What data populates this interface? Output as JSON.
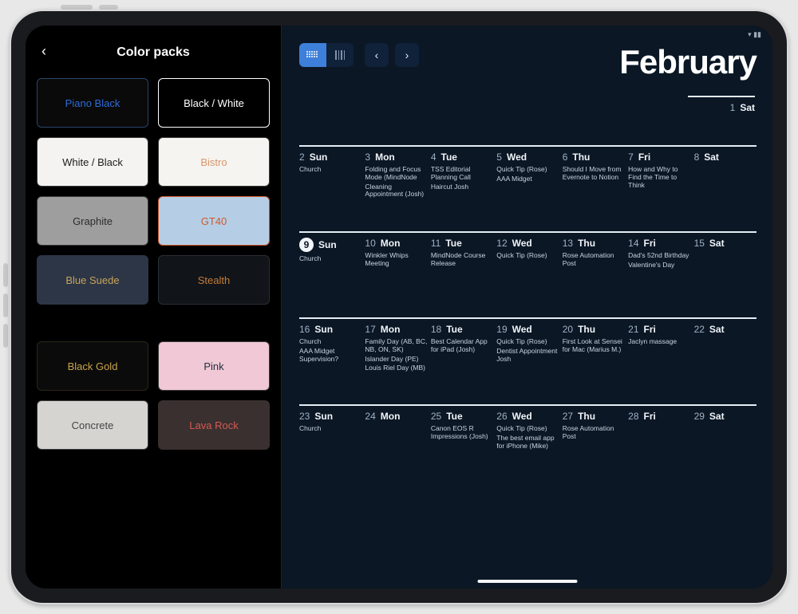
{
  "left": {
    "title": "Color packs",
    "packs": [
      {
        "label": "Piano Black",
        "bg": "#0a0a0a",
        "fg": "#2f6bd6",
        "border": "#29446b"
      },
      {
        "label": "Black / White",
        "bg": "#000000",
        "fg": "#ffffff",
        "border": "#ffffff"
      },
      {
        "label": "White / Black",
        "bg": "#f4f3f1",
        "fg": "#1c1c1c",
        "border": "#3a3a3a"
      },
      {
        "label": "Bistro",
        "bg": "#f6f4f0",
        "fg": "#d7956c",
        "border": "#3a3a3a"
      },
      {
        "label": "Graphite",
        "bg": "#9e9e9e",
        "fg": "#2c2c2c",
        "border": "#3a3a3a"
      },
      {
        "label": "GT40",
        "bg": "#b5cee6",
        "fg": "#d05a2a",
        "border": "#d05a2a"
      },
      {
        "label": "Blue Suede",
        "bg": "#2c3646",
        "fg": "#c9a35b",
        "border": "#2c3646"
      },
      {
        "label": "Stealth",
        "bg": "#111418",
        "fg": "#c77d3a",
        "border": "#2a2f35"
      }
    ],
    "packs2": [
      {
        "label": "Black Gold",
        "bg": "#0b0b0b",
        "fg": "#c9a54a",
        "border": "#2a2618"
      },
      {
        "label": "Pink",
        "bg": "#f1c8d5",
        "fg": "#233041",
        "border": "#3a3a3a"
      },
      {
        "label": "Concrete",
        "bg": "#d6d4d0",
        "fg": "#444444",
        "border": "#3a3a3a"
      },
      {
        "label": "Lava Rock",
        "bg": "#3a3030",
        "fg": "#d45a52",
        "border": "#3a3030"
      }
    ]
  },
  "calendar": {
    "month": "February",
    "first_day": {
      "num": "1",
      "name": "Sat"
    },
    "weeks": [
      [
        {
          "num": "2",
          "name": "Sun",
          "events": [
            "Church"
          ]
        },
        {
          "num": "3",
          "name": "Mon",
          "events": [
            "Folding and Focus Mode (MindNode",
            "Cleaning Appointment (Josh)"
          ]
        },
        {
          "num": "4",
          "name": "Tue",
          "events": [
            "TSS Editorial Planning Call",
            "Haircut Josh"
          ]
        },
        {
          "num": "5",
          "name": "Wed",
          "events": [
            "Quick Tip (Rose)",
            "AAA Midget"
          ]
        },
        {
          "num": "6",
          "name": "Thu",
          "events": [
            "Should I Move from Evernote to Notion"
          ]
        },
        {
          "num": "7",
          "name": "Fri",
          "events": [
            "How and Why to Find the Time to Think"
          ]
        },
        {
          "num": "8",
          "name": "Sat",
          "events": []
        }
      ],
      [
        {
          "num": "9",
          "name": "Sun",
          "today": true,
          "events": [
            "Church"
          ]
        },
        {
          "num": "10",
          "name": "Mon",
          "events": [
            "Winkler Whips Meeting"
          ]
        },
        {
          "num": "11",
          "name": "Tue",
          "events": [
            "MindNode Course Release"
          ]
        },
        {
          "num": "12",
          "name": "Wed",
          "events": [
            "Quick Tip (Rose)"
          ]
        },
        {
          "num": "13",
          "name": "Thu",
          "events": [
            "Rose Automation Post"
          ]
        },
        {
          "num": "14",
          "name": "Fri",
          "events": [
            "Dad's 52nd Birthday",
            "Valentine's Day"
          ]
        },
        {
          "num": "15",
          "name": "Sat",
          "events": []
        }
      ],
      [
        {
          "num": "16",
          "name": "Sun",
          "events": [
            "Church",
            "AAA Midget Supervision?"
          ]
        },
        {
          "num": "17",
          "name": "Mon",
          "events": [
            "Family Day (AB, BC, NB, ON, SK)",
            "Islander Day (PE)",
            "Louis Riel Day (MB)"
          ]
        },
        {
          "num": "18",
          "name": "Tue",
          "events": [
            "Best Calendar App for iPad (Josh)"
          ]
        },
        {
          "num": "19",
          "name": "Wed",
          "events": [
            "Quick Tip (Rose)",
            "Dentist Appointment Josh"
          ]
        },
        {
          "num": "20",
          "name": "Thu",
          "events": [
            "First Look at Sensei for Mac (Marius M.)"
          ]
        },
        {
          "num": "21",
          "name": "Fri",
          "events": [
            "Jaclyn massage"
          ]
        },
        {
          "num": "22",
          "name": "Sat",
          "events": []
        }
      ],
      [
        {
          "num": "23",
          "name": "Sun",
          "events": [
            "Church"
          ]
        },
        {
          "num": "24",
          "name": "Mon",
          "events": []
        },
        {
          "num": "25",
          "name": "Tue",
          "events": [
            "Canon EOS R Impressions (Josh)"
          ]
        },
        {
          "num": "26",
          "name": "Wed",
          "events": [
            "Quick Tip (Rose)",
            "The best email app for iPhone (Mike)"
          ]
        },
        {
          "num": "27",
          "name": "Thu",
          "events": [
            "Rose Automation Post"
          ]
        },
        {
          "num": "28",
          "name": "Fri",
          "events": []
        },
        {
          "num": "29",
          "name": "Sat",
          "events": []
        }
      ]
    ]
  }
}
